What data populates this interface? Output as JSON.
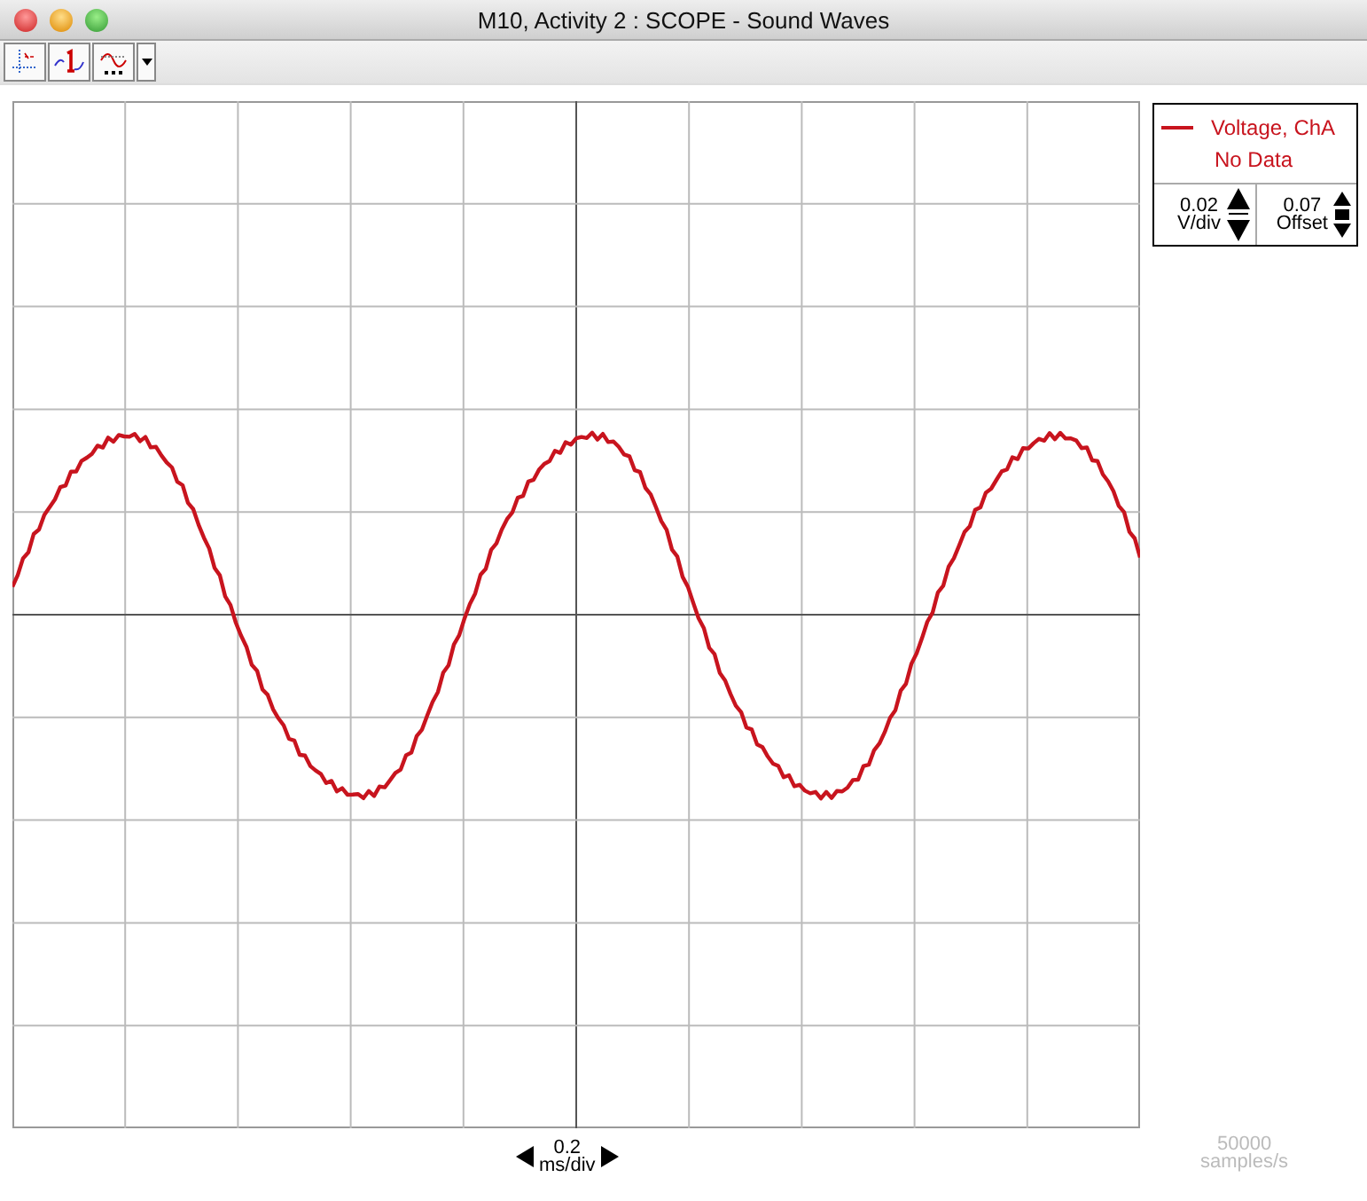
{
  "window": {
    "title": "M10, Activity 2 :  SCOPE - Sound Waves"
  },
  "legend": {
    "series": "Voltage, ChA",
    "status": "No Data"
  },
  "vertical_scale": {
    "value": "0.02",
    "unit": "V/div"
  },
  "offset": {
    "value": "0.07",
    "unit": "Offset"
  },
  "time_base": {
    "value": "0.2",
    "unit": "ms/div"
  },
  "sample_rate": {
    "value": "50000",
    "unit": "samples/s"
  }
}
